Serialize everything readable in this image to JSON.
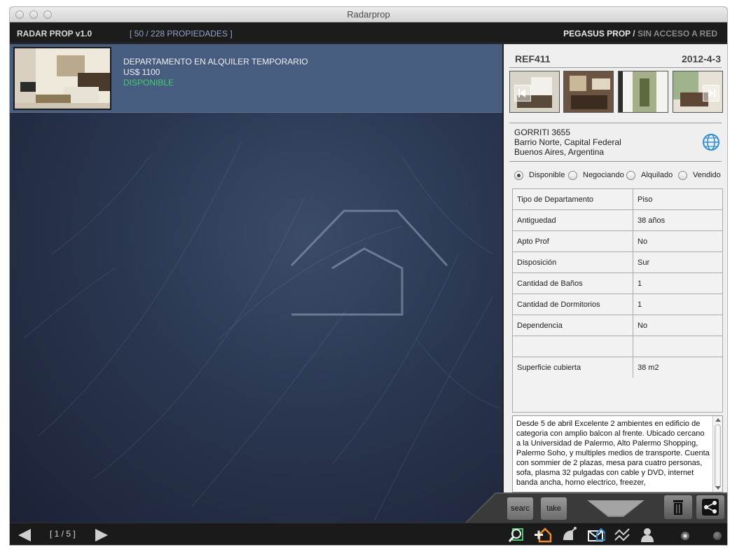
{
  "window": {
    "title": "Radarprop"
  },
  "header": {
    "app_name": "RADAR PROP v1.0",
    "property_count": "[ 50 / 228 PROPIEDADES ]",
    "network_name": "PEGASUS PROP",
    "network_sep": "/",
    "network_status": "SIN ACCESO A RED"
  },
  "listing": {
    "title": "DEPARTAMENTO EN ALQUILER TEMPORARIO",
    "price": "US$ 1100",
    "status": "DISPONIBLE"
  },
  "detail": {
    "ref": "REF411",
    "date": "2012-4-3",
    "address_line1": "GORRITI 3655",
    "address_line2": "Barrio Norte, Capital Federal",
    "address_line3": "Buenos Aires, Argentina",
    "status_options": [
      {
        "label": "Disponible",
        "selected": true
      },
      {
        "label": "Negociando",
        "selected": false
      },
      {
        "label": "Alquilado",
        "selected": false
      },
      {
        "label": "Vendido",
        "selected": false
      }
    ],
    "specs": [
      {
        "key": "Tipo de Departamento",
        "value": "Piso"
      },
      {
        "key": "Antiguedad",
        "value": "38 años"
      },
      {
        "key": "Apto Prof",
        "value": "No"
      },
      {
        "key": "Disposición",
        "value": "Sur"
      },
      {
        "key": "Cantidad de Baños",
        "value": "1"
      },
      {
        "key": "Cantidad de Dormitorios",
        "value": "1"
      },
      {
        "key": "Dependencia",
        "value": "No"
      },
      {
        "key": "",
        "value": ""
      },
      {
        "key": "Superficie cubierta",
        "value": "38 m2"
      }
    ],
    "description": "Desde 5 de abril Excelente 2 ambientes en edificio de categoria con amplio balcon al frente. Ubicado cercano a la Universidad de Palermo, Alto Palermo Shopping, Palermo Soho, y multiples medios de transporte. Cuenta con sommier de 2 plazas, mesa para cuatro personas, sofa, plasma 32 pulgadas con cable y DVD, internet banda ancha, horno electrico, freezer,"
  },
  "actions": {
    "search_label": "searc",
    "take_label": "take"
  },
  "footer": {
    "pager": "[ 1 / 5 ]"
  },
  "colors": {
    "accent_green": "#3fd06b",
    "listing_bg": "#475d7f",
    "globe_blue": "#2e8fd6"
  },
  "icons": [
    "prev-arrow-icon",
    "next-arrow-icon",
    "globe-icon",
    "trash-icon",
    "share-icon",
    "search-map-icon",
    "add-home-icon",
    "satellite-icon",
    "mail-home-icon",
    "trend-icon",
    "contacts-icon"
  ]
}
